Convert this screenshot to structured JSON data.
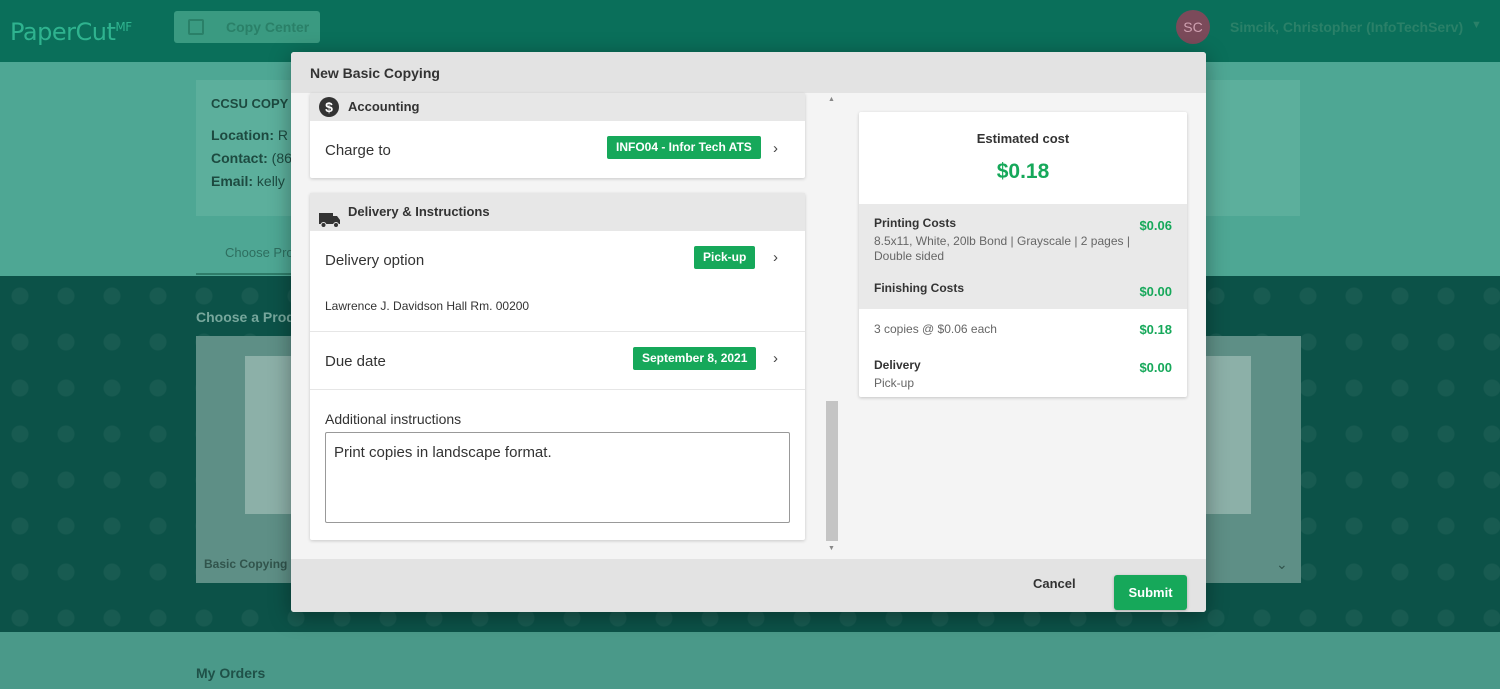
{
  "app": {
    "logo": "PaperCut",
    "logo_suffix": "MF",
    "nav_item": "Copy Center",
    "user_initials": "SC",
    "user_name": "Simcik, Christopher (InfoTechServ)"
  },
  "background": {
    "info_title": "CCSU COPY C",
    "location_label": "Location:",
    "location_value": "R",
    "contact_label": "Contact:",
    "contact_value": "(86",
    "email_label": "Email:",
    "email_value": "kelly",
    "tab_label": "Choose Pro",
    "choose_product": "Choose a Prod",
    "product_label": "Basic Copying",
    "my_orders": "My Orders"
  },
  "modal": {
    "title": "New Basic Copying",
    "accounting": {
      "heading": "Accounting",
      "charge_label": "Charge to",
      "charge_value": "INFO04 - Infor Tech ATS"
    },
    "delivery": {
      "heading": "Delivery & Instructions",
      "option_label": "Delivery option",
      "option_value": "Pick-up",
      "address": "Lawrence J. Davidson Hall Rm. 00200",
      "due_label": "Due date",
      "due_value": "September 8, 2021",
      "instructions_label": "Additional instructions",
      "instructions_value": "Print copies in landscape format."
    },
    "cost": {
      "estimated_label": "Estimated cost",
      "estimated_total": "$0.18",
      "printing_title": "Printing Costs",
      "printing_amount": "$0.06",
      "printing_detail": "8.5x11, White, 20lb Bond | Grayscale | 2 pages | Double sided",
      "finishing_title": "Finishing Costs",
      "finishing_amount": "$0.00",
      "copies_text": "3 copies @ $0.06 each",
      "copies_amount": "$0.18",
      "delivery_title": "Delivery",
      "delivery_amount": "$0.00",
      "delivery_detail": "Pick-up"
    },
    "footer": {
      "cancel": "Cancel",
      "submit": "Submit"
    }
  },
  "colors": {
    "accent": "#16a85a",
    "header_bar": "#0a6f5a"
  }
}
